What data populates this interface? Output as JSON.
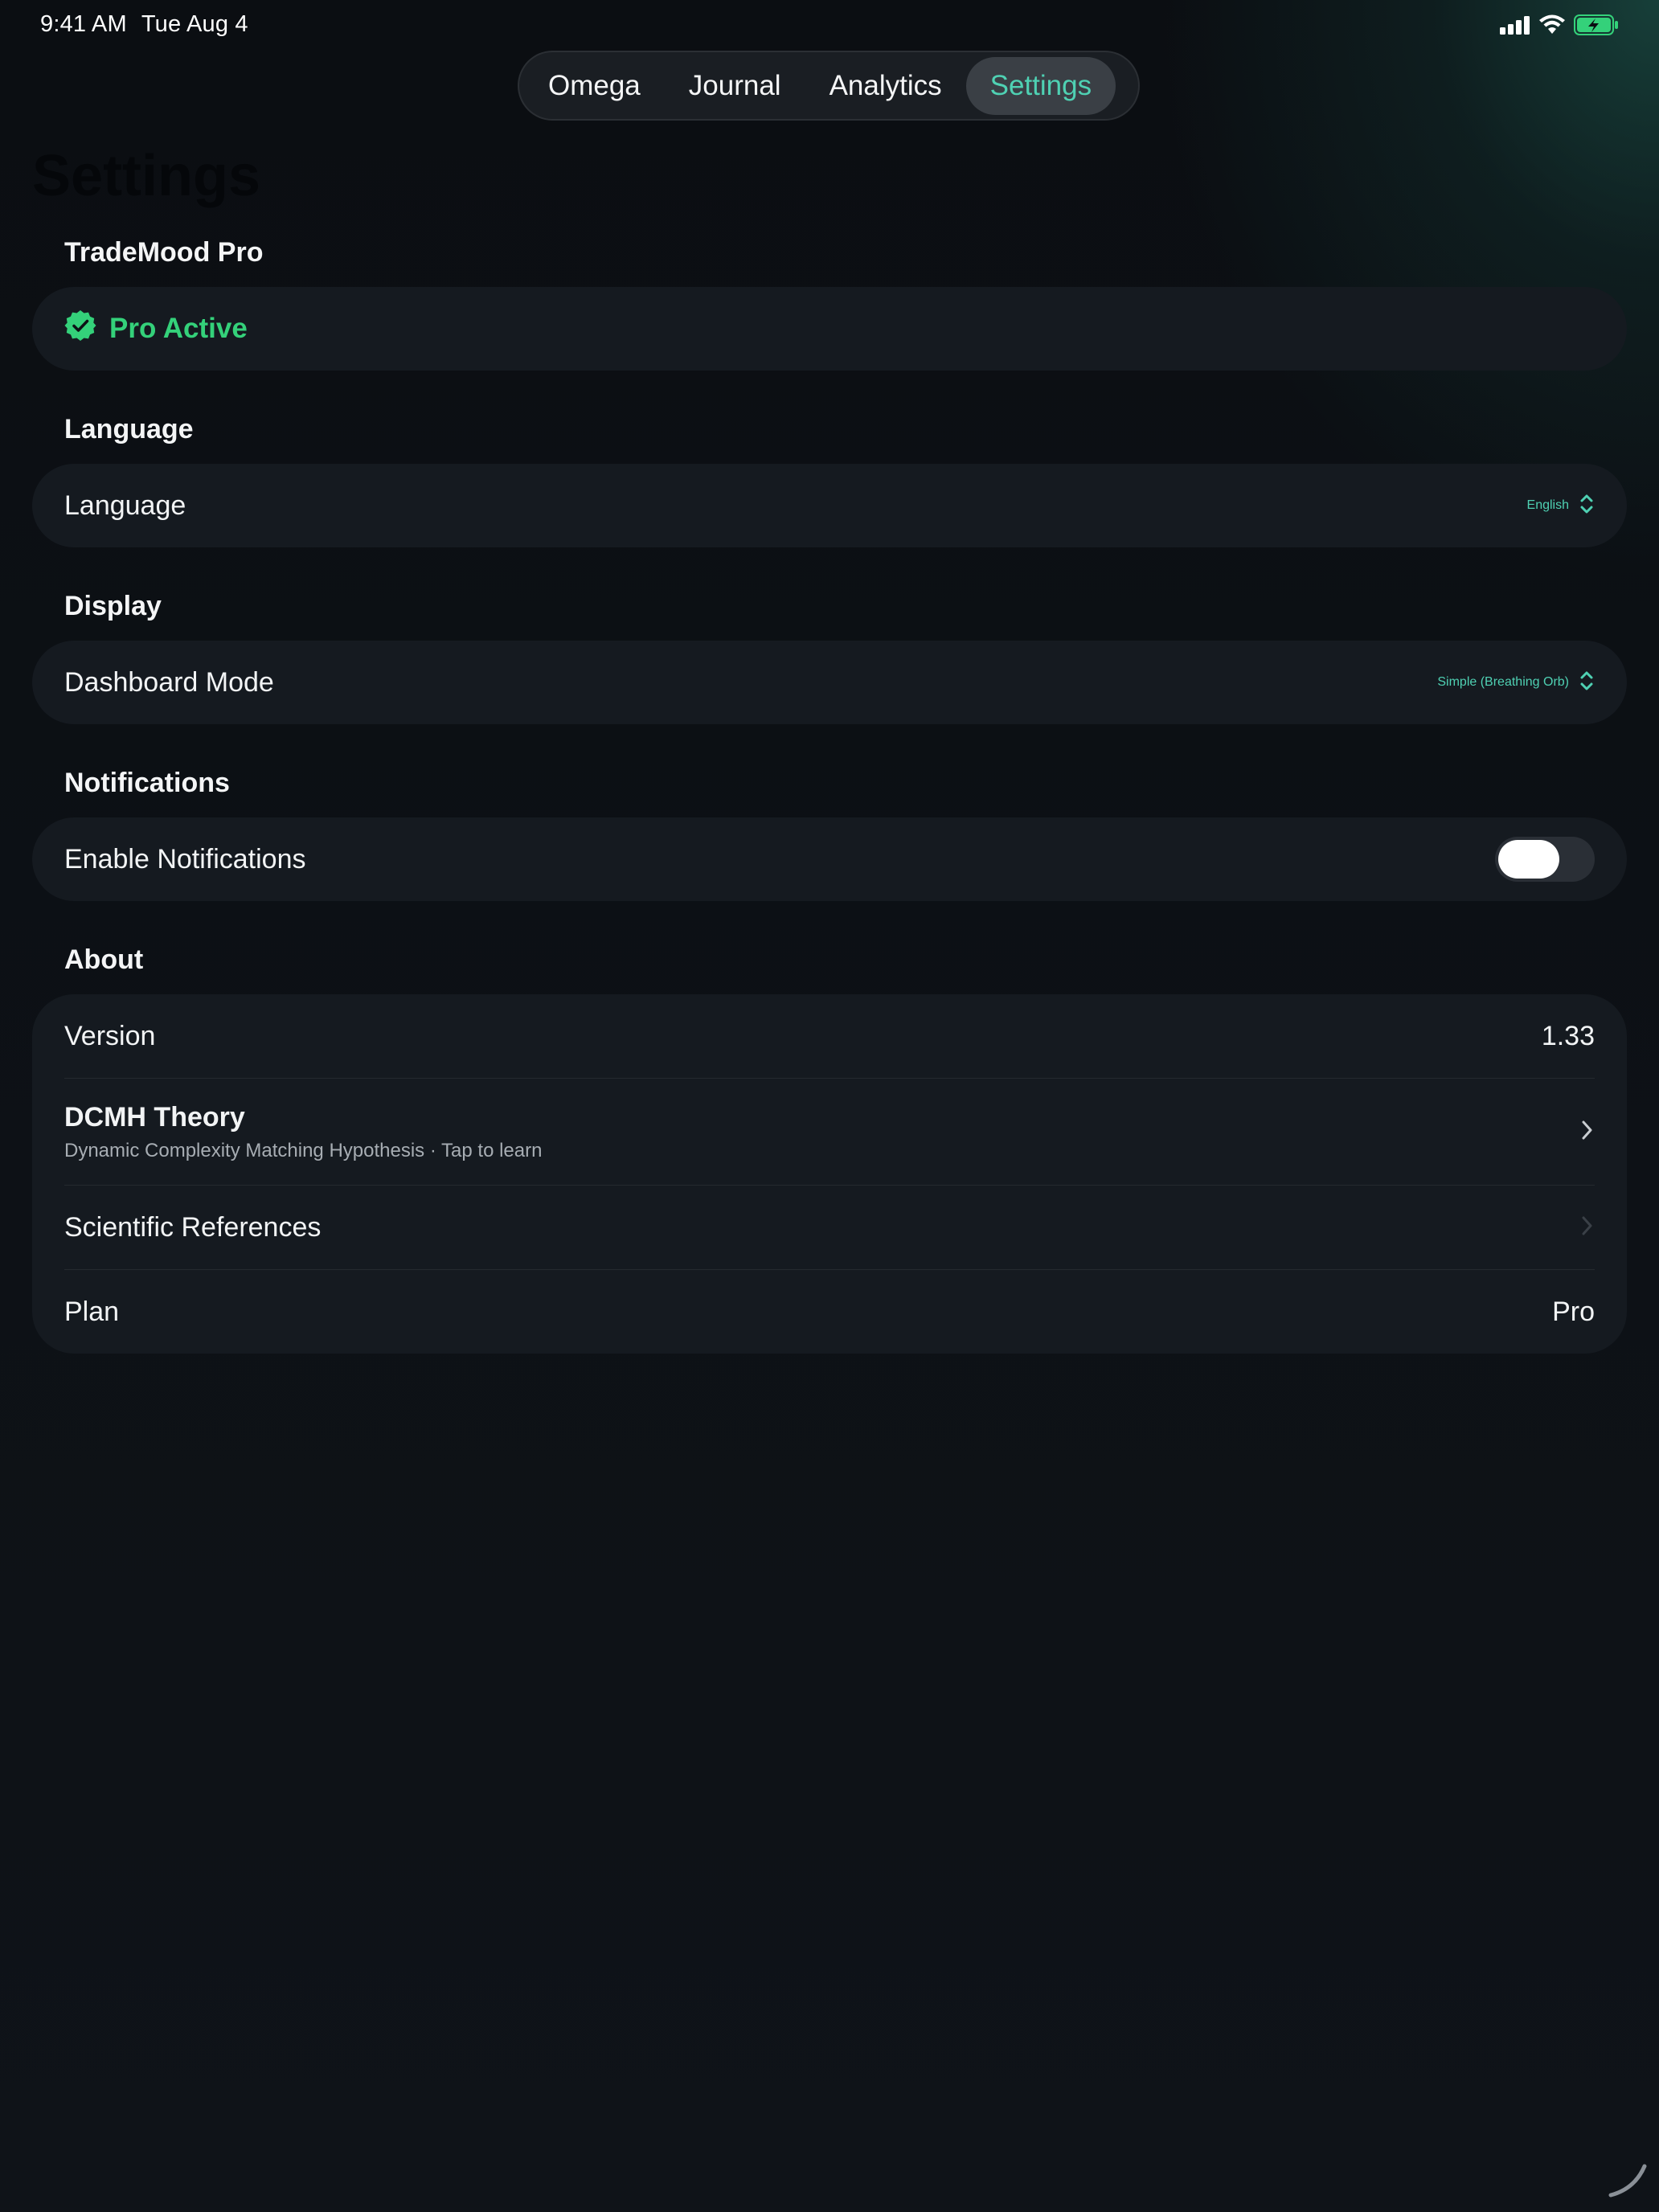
{
  "status_bar": {
    "time": "9:41 AM",
    "date": "Tue Aug 4",
    "icons": [
      "cellular-signal-icon",
      "wifi-icon",
      "battery-charging-icon"
    ],
    "battery_color": "#34d17a"
  },
  "tabs": [
    {
      "label": "Omega",
      "active": false
    },
    {
      "label": "Journal",
      "active": false
    },
    {
      "label": "Analytics",
      "active": false
    },
    {
      "label": "Settings",
      "active": true
    }
  ],
  "page_title": "Settings",
  "sections": {
    "pro": {
      "header": "TradeMood Pro",
      "status_label": "Pro Active",
      "status_icon": "verified-badge-icon"
    },
    "language": {
      "header": "Language",
      "row_label": "Language",
      "value": "English",
      "value_icon": "chevron-up-down-icon"
    },
    "display": {
      "header": "Display",
      "row_label": "Dashboard Mode",
      "value": "Simple (Breathing Orb)",
      "value_icon": "chevron-up-down-icon"
    },
    "notifications": {
      "header": "Notifications",
      "row_label": "Enable Notifications",
      "enabled": false
    },
    "about": {
      "header": "About",
      "version_label": "Version",
      "version_value": "1.33",
      "dcmh_title": "DCMH Theory",
      "dcmh_subtitle": "Dynamic Complexity Matching Hypothesis · Tap to learn",
      "references_label": "Scientific References",
      "plan_label": "Plan",
      "plan_value": "Pro"
    }
  },
  "colors": {
    "accent": "#4fd1b3",
    "pro_green": "#34d17a",
    "card_bg": "#151a20",
    "background": "#0d1116"
  }
}
